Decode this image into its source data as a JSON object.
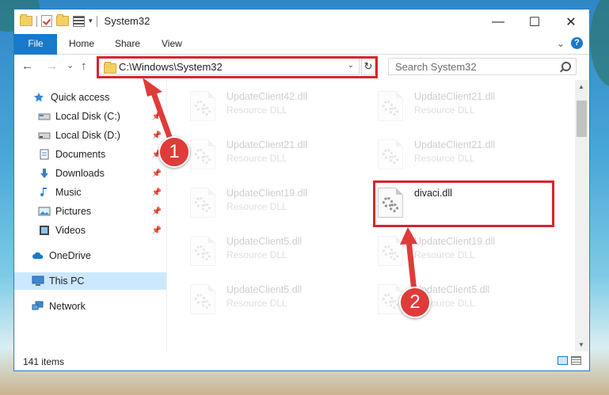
{
  "window": {
    "title": "System32",
    "minimize_glyph": "—",
    "maximize_glyph": "☐",
    "close_glyph": "✕"
  },
  "ribbon": {
    "tabs": [
      {
        "label": "File"
      },
      {
        "label": "Home"
      },
      {
        "label": "Share"
      },
      {
        "label": "View"
      }
    ],
    "help_label": "?",
    "expand_glyph": "⌄"
  },
  "navigation": {
    "back_glyph": "←",
    "forward_glyph": "→",
    "recent_glyph": "⌄",
    "up_glyph": "↑",
    "address": "C:\\Windows\\System32",
    "refresh_glyph": "↻",
    "search_placeholder": "Search System32"
  },
  "sidebar": {
    "items": [
      {
        "label": "Quick access",
        "icon": "star-icon",
        "pinned": false
      },
      {
        "label": "Local Disk (C:)",
        "icon": "drive-icon",
        "pinned": true
      },
      {
        "label": "Local Disk (D:)",
        "icon": "drive-icon",
        "pinned": true
      },
      {
        "label": "Documents",
        "icon": "documents-icon",
        "pinned": true
      },
      {
        "label": "Downloads",
        "icon": "download-icon",
        "pinned": true
      },
      {
        "label": "Music",
        "icon": "music-icon",
        "pinned": true
      },
      {
        "label": "Pictures",
        "icon": "pictures-icon",
        "pinned": true
      },
      {
        "label": "Videos",
        "icon": "videos-icon",
        "pinned": true
      },
      {
        "label": "OneDrive",
        "icon": "cloud-icon",
        "pinned": false
      },
      {
        "label": "This PC",
        "icon": "computer-icon",
        "pinned": false,
        "selected": true
      },
      {
        "label": "Network",
        "icon": "network-icon",
        "pinned": false
      }
    ],
    "pin_glyph": "📌"
  },
  "files": [
    {
      "name": "UpdateClient42.dll",
      "type": "Resource DLL",
      "faded": true
    },
    {
      "name": "UpdateClient21.dll",
      "type": "Resource DLL",
      "faded": true
    },
    {
      "name": "UpdateClient21.dll",
      "type": "Resource DLL",
      "faded": true
    },
    {
      "name": "UpdateClient21.dll",
      "type": "Resource DLL",
      "faded": true
    },
    {
      "name": "UpdateClient19.dll",
      "type": "Resource DLL",
      "faded": true
    },
    {
      "name": "divaci.dll",
      "type": "",
      "faded": false
    },
    {
      "name": "UpdateClient5.dll",
      "type": "Resource DLL",
      "faded": true
    },
    {
      "name": "UpdateClient19.dll",
      "type": "Resource DLL",
      "faded": true
    },
    {
      "name": "UpdateClient5.dll",
      "type": "Resource DLL",
      "faded": true
    },
    {
      "name": "UpdateClient5.dll",
      "type": "Resource DLL",
      "faded": true
    }
  ],
  "status": {
    "item_count": "141 items"
  },
  "annotations": {
    "step1": "1",
    "step2": "2",
    "highlight_color": "#d9232d"
  },
  "colors": {
    "accent": "#1979ca",
    "selection": "#cce8ff"
  }
}
